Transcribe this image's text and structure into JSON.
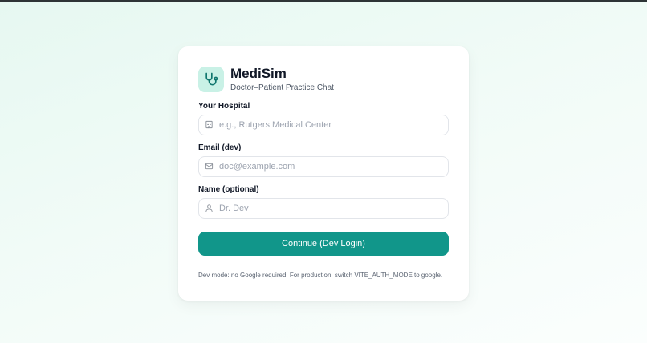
{
  "brand": {
    "title": "MediSim",
    "subtitle": "Doctor–Patient Practice Chat",
    "icon": "stethoscope-icon"
  },
  "form": {
    "hospital": {
      "label": "Your Hospital",
      "placeholder": "e.g., Rutgers Medical Center",
      "value": "",
      "icon": "hospital-icon"
    },
    "email": {
      "label": "Email (dev)",
      "placeholder": "doc@example.com",
      "value": "",
      "icon": "mail-icon"
    },
    "name": {
      "label": "Name (optional)",
      "placeholder": "Dr. Dev",
      "value": "",
      "icon": "user-icon"
    },
    "submit_label": "Continue (Dev Login)"
  },
  "footnote": "Dev mode: no Google required. For production, switch VITE_AUTH_MODE to google.",
  "colors": {
    "accent": "#11968a",
    "logo_bg": "#c9f1e6",
    "background": "#e6f8f1"
  }
}
